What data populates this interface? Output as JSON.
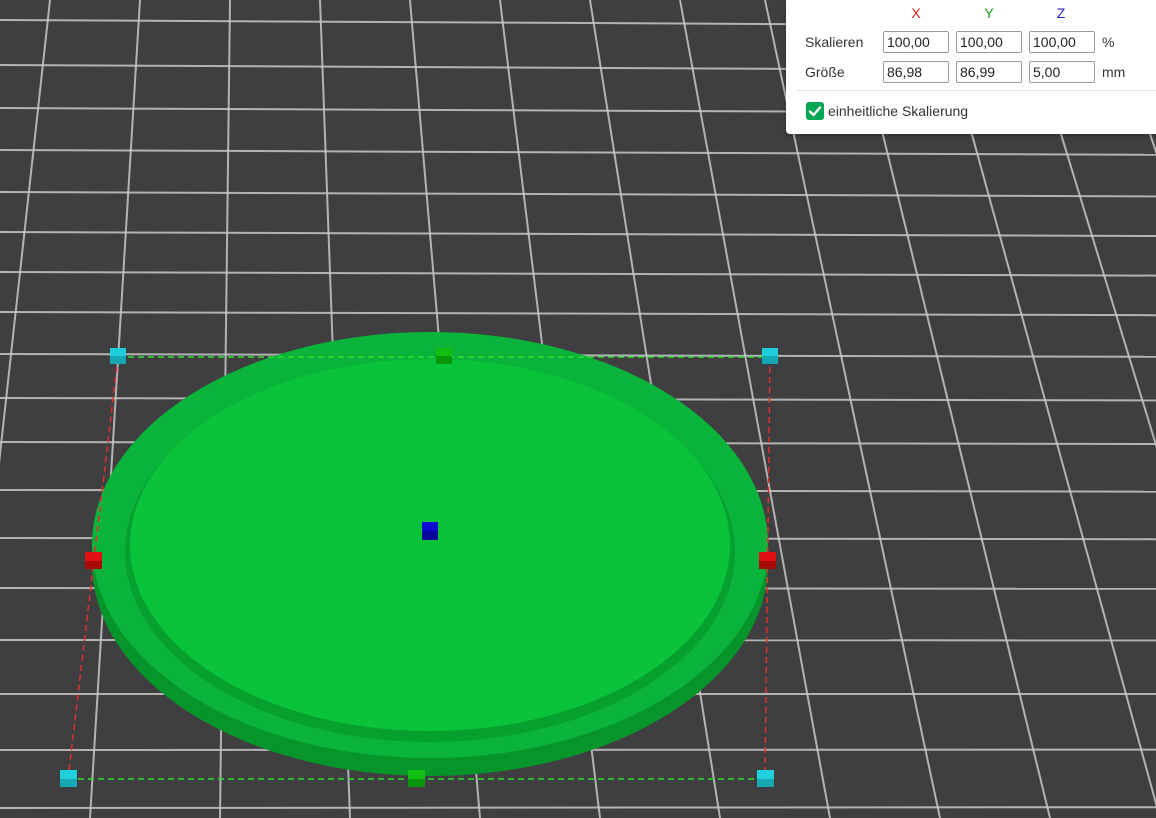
{
  "scale_panel": {
    "axes": [
      {
        "label": "X",
        "color": "#e02020"
      },
      {
        "label": "Y",
        "color": "#1aa01a"
      },
      {
        "label": "Z",
        "color": "#1c1cc8"
      }
    ],
    "scale": {
      "label": "Skalieren",
      "x": "100,00",
      "y": "100,00",
      "z": "100,00",
      "unit": "%"
    },
    "size": {
      "label": "Größe",
      "x": "86,98",
      "y": "86,99",
      "z": "5,00",
      "unit": "mm"
    },
    "uniform_scaling": {
      "label": "einheitliche Skalierung",
      "checked": true
    }
  },
  "viewport": {
    "model_color": "#09c43a",
    "model_rim_color": "#07a92f",
    "bed_color": "#3f3f42",
    "grid_color": "#c8c8c8",
    "handle_colors": {
      "corner": "#1fd0dc",
      "x_axis": "#e01010",
      "y_axis": "#10c010",
      "z_axis": "#0a0ad0"
    },
    "bbox_colors": {
      "x_edges": "#33dd33",
      "y_edges": "#e03030"
    }
  }
}
